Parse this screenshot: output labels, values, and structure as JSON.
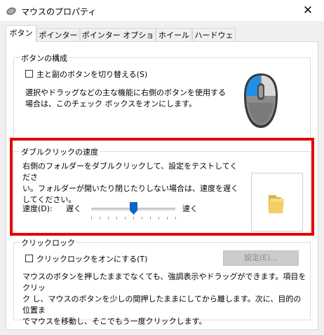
{
  "window": {
    "title": "マウスのプロパティ",
    "close_glyph": "✕"
  },
  "tabs": [
    {
      "label": "ボタン",
      "active": true
    },
    {
      "label": "ポインター",
      "active": false
    },
    {
      "label": "ポインター オプション",
      "active": false
    },
    {
      "label": "ホイール",
      "active": false
    },
    {
      "label": "ハードウェア",
      "active": false
    }
  ],
  "button_config": {
    "legend": "ボタンの構成",
    "switch_checkbox_label": "主と副のボタンを切り替える(S)",
    "switch_checked": false,
    "desc_lines": [
      "選択やドラッグなどの主な機能に右側のボタンを使用する",
      "場合は、このチェック ボックスをオンにします。"
    ]
  },
  "double_click": {
    "legend": "ダブルクリックの速度",
    "desc_lines": [
      "右側のフォルダーをダブルクリックして、設定をテストしてくださ",
      "い。フォルダーが開いたり閉じたりしない場合は、速度を遅く",
      "してください。"
    ],
    "speed_label": "速度(D):",
    "slow_label": "遅く",
    "fast_label": "速く",
    "speed_value": 0.5
  },
  "click_lock": {
    "legend": "クリックロック",
    "checkbox_label": "クリックロックをオンにする(T)",
    "checked": false,
    "settings_button": "設定(E)...",
    "desc_lines": [
      "マウスのボタンを押したままでなくても、強調表示やドラッグができます。項目をクリッ",
      "ク し、マウスのボタンを少しの間押したままにしてから離します。次に、目的の位置ま",
      "でマウスを移動し、そこでもう一度クリックします。"
    ]
  },
  "colors": {
    "highlight": "#e60000",
    "mouse_button_accent": "#1e90e6",
    "slider_thumb": "#0a64c8",
    "folder": "#f3cf63"
  },
  "icons": {
    "app": "mouse-icon",
    "close": "close-icon",
    "mouse": "mouse-illustration-icon",
    "folder": "folder-icon"
  }
}
